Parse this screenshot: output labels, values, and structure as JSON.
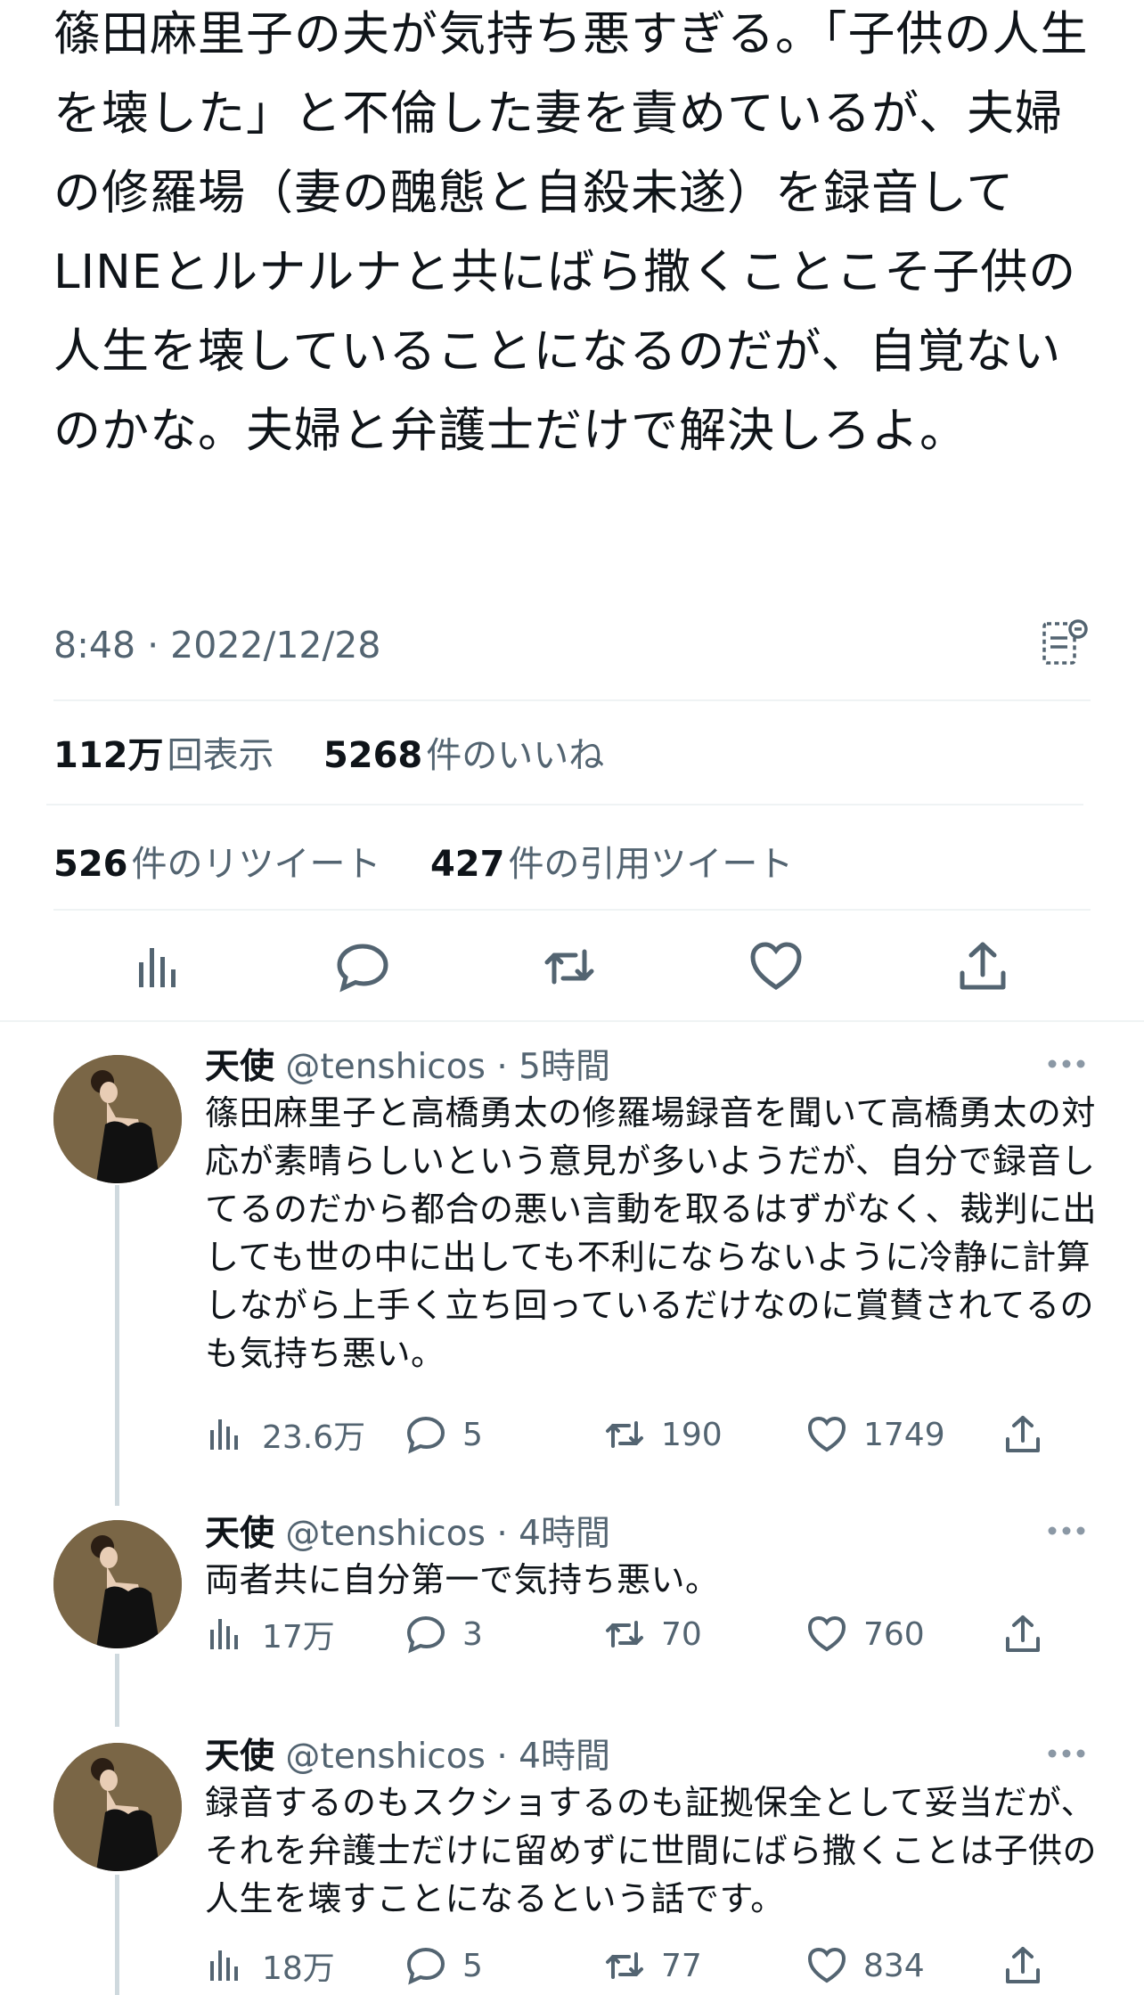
{
  "tweet": {
    "text": "篠田麻里子の夫が気持ち悪すぎる。「子供の人生を壊した」と不倫した妻を責めているが、夫婦の修羅場（妻の醜態と自殺未遂）を録音してLINEとルナルナと共にばら撒くことこそ子供の人生を壊していることになるのだが、自覚ないのかな。夫婦と弁護士だけで解決しろよ。",
    "time": "8:48 · 2022/12/28",
    "views_count": "112万",
    "views_label": "回表示",
    "likes_count": "5268",
    "likes_label": "件のいいね",
    "retweets_count": "526",
    "retweets_label": "件のリツイート",
    "quotes_count": "427",
    "quotes_label": "件の引用ツイート",
    "icons": [
      "analytics-icon",
      "reply-icon",
      "retweet-icon",
      "like-icon",
      "share-icon",
      "notes-icon"
    ]
  },
  "replies": [
    {
      "name": "天使",
      "handle": "@tenshicos",
      "dot": "·",
      "ago": "5時間",
      "text": "篠田麻里子と高橋勇太の修羅場録音を聞いて高橋勇太の対応が素晴らしいという意見が多いようだが、自分で録音してるのだから都合の悪い言動を取るはずがなく、裁判に出しても世の中に出しても不利にならないように冷静に計算しながら上手く立ち回っているだけなのに賞賛されてるのも気持ち悪い。",
      "views": "23.6万",
      "replies": "5",
      "retweets": "190",
      "likes": "1749"
    },
    {
      "name": "天使",
      "handle": "@tenshicos",
      "dot": "·",
      "ago": "4時間",
      "text": "両者共に自分第一で気持ち悪い。",
      "views": "17万",
      "replies": "3",
      "retweets": "70",
      "likes": "760"
    },
    {
      "name": "天使",
      "handle": "@tenshicos",
      "dot": "·",
      "ago": "4時間",
      "text": "録音するのもスクショするのも証拠保全として妥当だが、それを弁護士だけに留めずに世間にばら撒くことは子供の人生を壊すことになるという話です。",
      "views": "18万",
      "replies": "5",
      "retweets": "77",
      "likes": "834"
    }
  ]
}
